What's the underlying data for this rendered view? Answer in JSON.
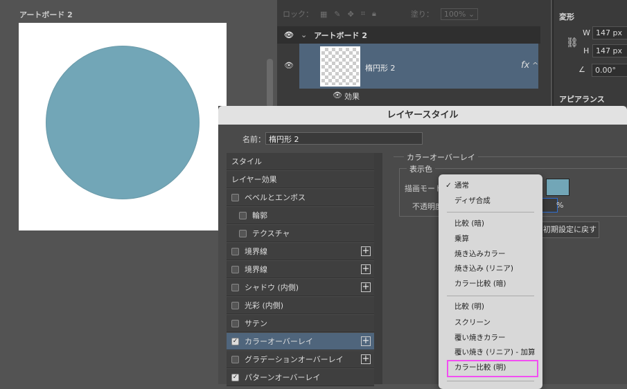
{
  "canvas": {
    "artboard_label": "アートボード 2",
    "shape_color": "#72a6b7"
  },
  "layers": {
    "lock_label": "ロック：",
    "fill_label": "塗り：",
    "fill_value": "100%",
    "artboard_name": "アートボード 2",
    "layer_name": "楕円形 2",
    "fx": "fx",
    "effects_label": "効果"
  },
  "properties": {
    "transform": "変形",
    "w_label": "W",
    "w_value": "147 px",
    "h_label": "H",
    "h_value": "147 px",
    "angle": "0.00°",
    "appearance": "アピアランス"
  },
  "dialog": {
    "title": "レイヤースタイル",
    "name_label": "名前：",
    "name_value": "楕円形 2",
    "list": [
      {
        "label": "スタイル",
        "cb": null,
        "plus": false
      },
      {
        "label": "レイヤー効果",
        "cb": null,
        "plus": false
      },
      {
        "label": "ベベルとエンボス",
        "cb": false,
        "plus": false
      },
      {
        "label": "輪郭",
        "cb": false,
        "plus": false,
        "indent": true
      },
      {
        "label": "テクスチャ",
        "cb": false,
        "plus": false,
        "indent": true
      },
      {
        "label": "境界線",
        "cb": false,
        "plus": true
      },
      {
        "label": "境界線",
        "cb": false,
        "plus": true
      },
      {
        "label": "シャドウ (内側)",
        "cb": false,
        "plus": true
      },
      {
        "label": "光彩 (内側)",
        "cb": false,
        "plus": false
      },
      {
        "label": "サテン",
        "cb": false,
        "plus": false
      },
      {
        "label": "カラーオーバーレイ",
        "cb": true,
        "plus": true,
        "selected": true
      },
      {
        "label": "グラデーションオーバーレイ",
        "cb": false,
        "plus": true
      },
      {
        "label": "パターンオーバーレイ",
        "cb": true,
        "plus": false
      }
    ],
    "section": "カラーオーバーレイ",
    "subsection": "表示色",
    "blend_label": "描画モード",
    "opacity_label": "不透明度",
    "percent": "%",
    "reset_button": "初期設定に戻す",
    "overlay_color": "#72a6b7"
  },
  "blend_menu": {
    "check": "✓",
    "items": [
      "通常",
      "ディザ合成",
      "-",
      "比較 (暗)",
      "乗算",
      "焼き込みカラー",
      "焼き込み (リニア)",
      "カラー比較 (暗)",
      "-",
      "比較 (明)",
      "スクリーン",
      "覆い焼きカラー",
      "覆い焼き (リニア) - 加算",
      "カラー比較 (明)",
      "-"
    ],
    "selected": "通常",
    "highlighted": "カラー比較 (明)"
  }
}
